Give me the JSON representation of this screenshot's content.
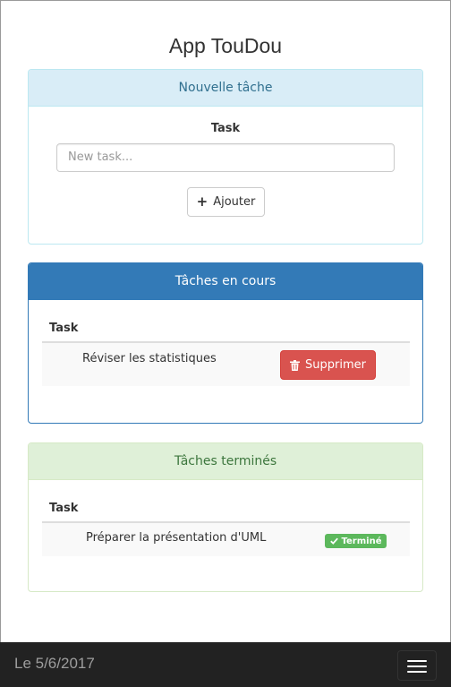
{
  "app": {
    "title": "App TouDou"
  },
  "new_task_panel": {
    "heading": "Nouvelle tâche",
    "field_label": "Task",
    "input": {
      "value": "",
      "placeholder": "New task..."
    },
    "add_button": {
      "icon": "plus-icon",
      "label": "Ajouter"
    }
  },
  "current_panel": {
    "heading": "Tâches en cours",
    "column_header": "Task",
    "rows": [
      {
        "task": "Réviser les statistiques",
        "delete_button": {
          "icon": "trash-icon",
          "label": "Supprimer"
        }
      }
    ]
  },
  "done_panel": {
    "heading": "Tâches terminés",
    "column_header": "Task",
    "rows": [
      {
        "task": "Préparer la présentation d'UML",
        "badge": {
          "icon": "check-icon",
          "label": "Terminé"
        }
      }
    ]
  },
  "footer": {
    "date_text": "Le 5/6/2017",
    "menu_icon": "hamburger-icon"
  },
  "colors": {
    "info_bg": "#d9edf7",
    "primary": "#337ab7",
    "success_bg": "#dff0d8",
    "danger": "#d9534f",
    "badge_success": "#5cb85c",
    "footer_bg": "#222222"
  }
}
